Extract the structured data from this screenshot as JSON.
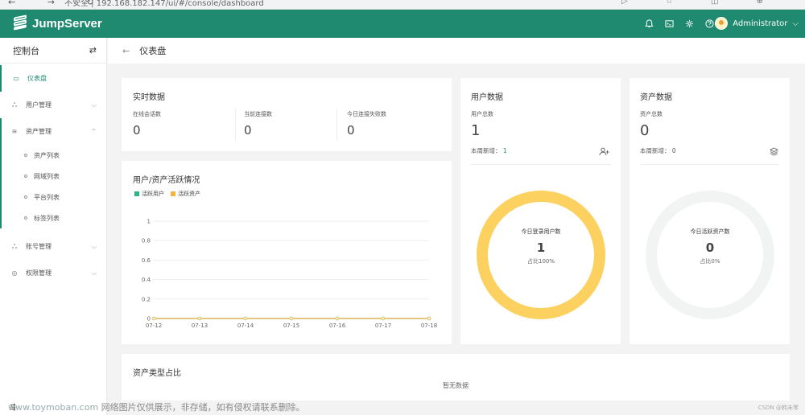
{
  "browser": {
    "nav": "← → ↻",
    "url": "不安全 | 192.168.182.147/ui/#/console/dashboard",
    "tools": "▷ ☆ ◫ ⊕"
  },
  "header": {
    "brand": "JumpServer",
    "icons": [
      "bell-icon",
      "terminal-icon",
      "gear-icon",
      "help-icon"
    ],
    "user": "Administrator",
    "user_caret": "⌵"
  },
  "sidebar": {
    "title": "控制台",
    "toggle": "⇄",
    "items": [
      {
        "label": "仪表盘",
        "icon": "▭",
        "active": true
      },
      {
        "label": "用户管理",
        "icon": "ஃ",
        "chev": "⌵"
      },
      {
        "label": "资产管理",
        "icon": "≋",
        "chev": "⌃"
      },
      {
        "label": "账号管理",
        "icon": "ஃ",
        "chev": "⌵"
      },
      {
        "label": "权限管理",
        "icon": "◎",
        "chev": "⌵"
      }
    ],
    "sub_items": [
      "资产列表",
      "网域列表",
      "平台列表",
      "标签列表"
    ],
    "bottom": "⇶"
  },
  "page": {
    "title": "仪表盘",
    "back": "←"
  },
  "realtime": {
    "title": "实时数据",
    "metrics": [
      {
        "label": "在线会话数",
        "value": "0"
      },
      {
        "label": "当前连接数",
        "value": "0"
      },
      {
        "label": "今日连接失败数",
        "value": "0"
      }
    ]
  },
  "users": {
    "title": "用户数据",
    "total_label": "用户总数",
    "total": "1",
    "new_label": "本周新增：",
    "new_value": "1",
    "ring_label": "今日登录用户数",
    "ring_value": "1",
    "ring_pct": "占比100%",
    "ring_fraction": 1.0,
    "ring_color": "#fcd15f"
  },
  "assets": {
    "title": "资产数据",
    "total_label": "资产总数",
    "total": "0",
    "new_label": "本周新增：",
    "new_value": "0",
    "ring_label": "今日活跃资产数",
    "ring_value": "0",
    "ring_pct": "占比0%",
    "ring_fraction": 0.0,
    "ring_color": "#f2f4f3"
  },
  "activity": {
    "title": "用户/资产活跃情况"
  },
  "asset_types": {
    "title": "资产类型占比",
    "empty": "暂无数据"
  },
  "watermark": {
    "domain": "www.toymoban.com",
    "text": " 网络图片仅供展示，非存储，如有侵权请联系删除。"
  },
  "credit": "CSDN @韩未零",
  "chart_data": {
    "type": "line",
    "categories": [
      "07-12",
      "07-13",
      "07-14",
      "07-15",
      "07-16",
      "07-17",
      "07-18"
    ],
    "series": [
      {
        "name": "活跃用户",
        "color": "#2bb389",
        "values": [
          0,
          0,
          0,
          0,
          0,
          0,
          0
        ]
      },
      {
        "name": "活跃资产",
        "color": "#f6b343",
        "values": [
          0,
          0,
          0,
          0,
          0,
          0,
          0
        ]
      }
    ],
    "yticks": [
      "0",
      "0.2",
      "0.4",
      "0.6",
      "0.8",
      "1"
    ],
    "ylim": [
      0,
      1
    ],
    "grid": true,
    "legend": "top-left"
  }
}
